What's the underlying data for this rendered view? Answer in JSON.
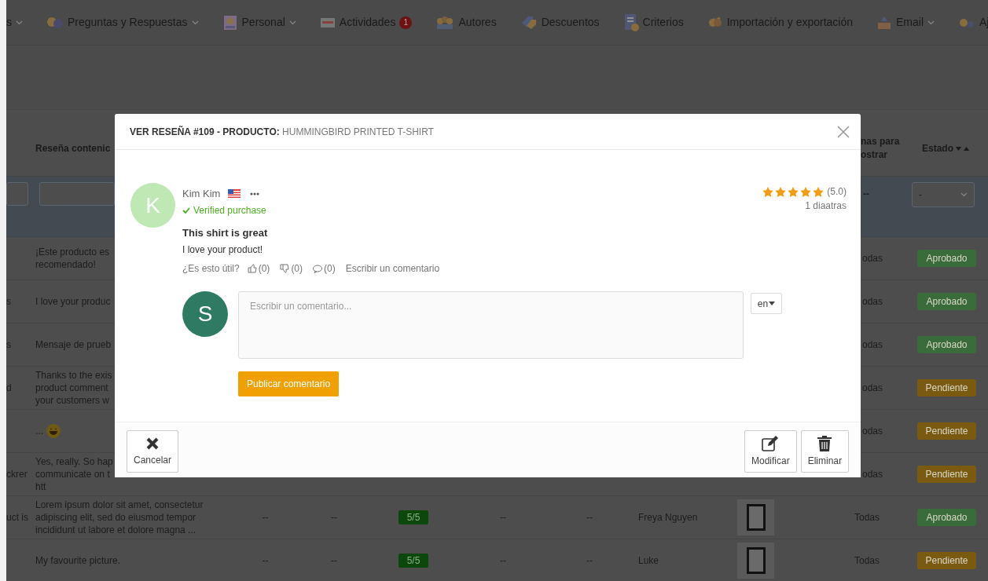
{
  "nav": [
    {
      "label": "s",
      "caret": true
    },
    {
      "label": "Preguntas y Respuestas",
      "caret": true
    },
    {
      "label": "Personal",
      "caret": true
    },
    {
      "label": "Actividades",
      "caret": false,
      "badge": "1"
    },
    {
      "label": "Autores",
      "caret": false
    },
    {
      "label": "Descuentos",
      "caret": false
    },
    {
      "label": "Criterios",
      "caret": false
    },
    {
      "label": "Importación y exportación",
      "caret": false
    },
    {
      "label": "Email",
      "caret": true
    },
    {
      "label": "Aj",
      "caret": false
    }
  ],
  "table": {
    "review_column": "Reseña contenic",
    "cut_column": [
      "nas para",
      "ostrar"
    ],
    "status_column": "Estado",
    "filter": {
      "cut_value": "--",
      "status_select": "-"
    },
    "rows": [
      {
        "lead": "",
        "review": [
          "¡Este producto es",
          "recomendado!"
        ],
        "emoji": false,
        "thumbnail": false,
        "shops": "odas",
        "status": "Aprobado",
        "color": "#3a6b3a"
      },
      {
        "lead": "s",
        "review": [
          "I love your produc"
        ],
        "emoji": false,
        "thumbnail": false,
        "shops": "odas",
        "status": "Aprobado",
        "color": "#3a6b3a"
      },
      {
        "lead": "s",
        "review": [
          "Mensaje de prueb"
        ],
        "emoji": false,
        "thumbnail": false,
        "shops": "odas",
        "status": "Aprobado",
        "color": "#3a6b3a"
      },
      {
        "lead": "d",
        "review": [
          "Thanks to the exis",
          "product comment",
          "your customers w"
        ],
        "emoji": false,
        "thumbnail": false,
        "shops": "odas",
        "status": "Pendiente",
        "color": "#7a5a10"
      },
      {
        "lead": "",
        "review": [
          "..."
        ],
        "emoji": true,
        "thumbnail": false,
        "shops": "odas",
        "status": "Pendiente",
        "color": "#7a5a10"
      },
      {
        "lead": "ckrer",
        "review": [
          "Yes, really. So hap",
          "communicate on t",
          "htt"
        ],
        "emoji": false,
        "thumbnail": false,
        "shops": "odas",
        "status": "Pendiente",
        "color": "#7a5a10"
      },
      {
        "lead": "uct is",
        "review": [
          "Lorem ipsum dolor sit amet, consectetur",
          "adipiscing elit, sed do eiusmod tempor",
          "incididunt ut labore et dolore magna ..."
        ],
        "cells": [
          {
            "text": "--",
            "kind": "plain"
          },
          {
            "text": "--",
            "kind": "plain"
          },
          {
            "text": "5/5",
            "kind": "score"
          },
          {
            "text": "--",
            "kind": "plain"
          },
          {
            "text": "--",
            "kind": "plain"
          }
        ],
        "author": "Freya Nguyen",
        "emoji": false,
        "thumbnail": true,
        "shops": "Todas",
        "status": "Aprobado",
        "color": "#3a6b3a"
      },
      {
        "lead": "",
        "review": [
          "My favourite picture."
        ],
        "cells": [
          {
            "text": "--",
            "kind": "plain"
          },
          {
            "text": "--",
            "kind": "plain"
          },
          {
            "text": "5/5",
            "kind": "score"
          },
          {
            "text": "--",
            "kind": "plain"
          },
          {
            "text": "--",
            "kind": "plain"
          }
        ],
        "author": "Luke",
        "emoji": false,
        "thumbnail": true,
        "shops": "Todas",
        "status": "Pendiente",
        "color": "#7a5a10"
      }
    ]
  },
  "modal": {
    "title": "VER RESEÑA #109 - PRODUCTO:",
    "product": "HUMMINGBIRD PRINTED T-SHIRT",
    "review": {
      "avatar_letter": "K",
      "author": "Kim Kim",
      "verified": "Verified purchase",
      "stars": 5,
      "rating": "(5.0)",
      "time": "1 diaatras",
      "title": "This shirt is great",
      "body": "I love your product!",
      "helpful_label": "¿Es esto útil?",
      "likes": "(0)",
      "dislikes": "(0)",
      "comments": "(0)",
      "write_comment": "Escribir un comentario"
    },
    "reply": {
      "avatar_letter": "S",
      "placeholder": "Escribir un comentario...",
      "language": "en",
      "submit": "Publicar comentario"
    },
    "footer": {
      "cancel": "Cancelar",
      "edit": "Modificar",
      "delete": "Eliminar"
    }
  }
}
